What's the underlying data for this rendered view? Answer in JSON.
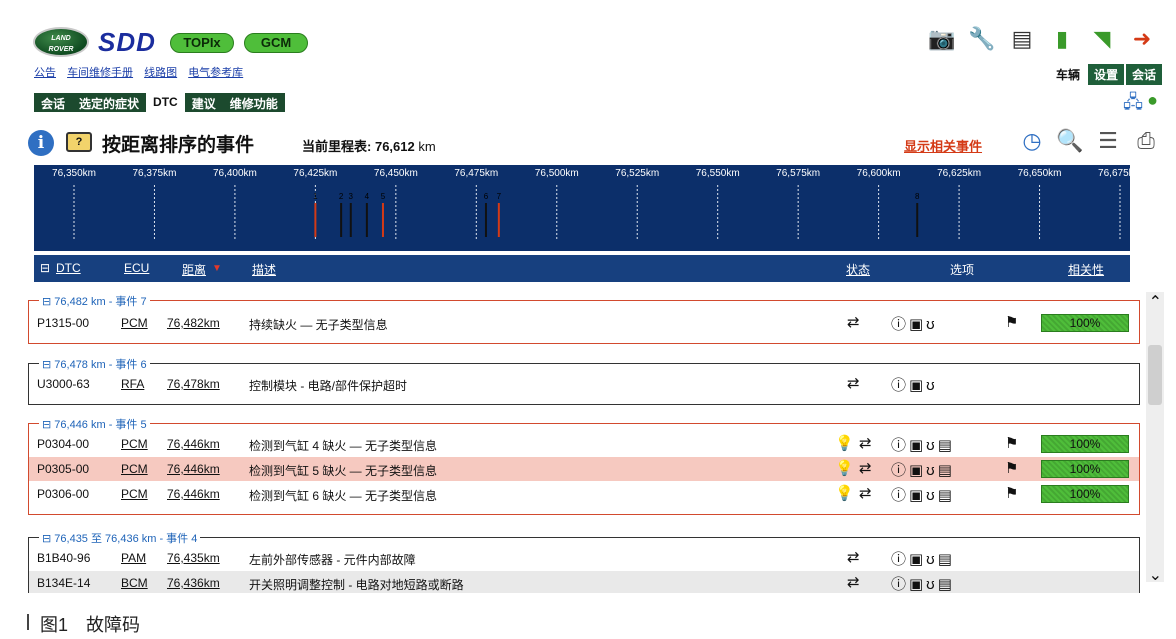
{
  "header": {
    "logo_text": "LAND ROVER",
    "brand": "SDD",
    "pills": [
      "TOPIx",
      "GCM"
    ],
    "links": [
      "公告",
      "车间维修手册",
      "线路图",
      "电气参考库"
    ],
    "icons": [
      "camera-icon",
      "wrench-icon",
      "battery-icon",
      "book-icon",
      "wifi-icon",
      "exit-icon"
    ],
    "right_tabs": [
      "车辆",
      "设置",
      "会话"
    ]
  },
  "nav": {
    "tabs": [
      "会话",
      "选定的症状",
      "DTC",
      "建议",
      "维修功能"
    ],
    "active": "DTC"
  },
  "title": {
    "text": "按距离排序的事件",
    "odo_label": "当前里程表:",
    "odo_value": "76,612",
    "odo_unit": "km",
    "show_related": "显示相关事件"
  },
  "timeline": {
    "ticks": [
      "76,350km",
      "76,375km",
      "76,400km",
      "76,425km",
      "76,450km",
      "76,475km",
      "76,500km",
      "76,525km",
      "76,550km",
      "76,575km",
      "76,600km",
      "76,625km",
      "76,650km",
      "76,675km"
    ],
    "tick_values": [
      76350,
      76375,
      76400,
      76425,
      76450,
      76475,
      76500,
      76525,
      76550,
      76575,
      76600,
      76625,
      76650,
      76675
    ],
    "events": [
      {
        "label": "1",
        "km": 76425,
        "color": "#d43a16"
      },
      {
        "label": "2",
        "km": 76433,
        "color": "#111111"
      },
      {
        "label": "3",
        "km": 76436,
        "color": "#111111"
      },
      {
        "label": "4",
        "km": 76441,
        "color": "#111111"
      },
      {
        "label": "5",
        "km": 76446,
        "color": "#d43a16"
      },
      {
        "label": "6",
        "km": 76478,
        "color": "#111111"
      },
      {
        "label": "7",
        "km": 76482,
        "color": "#d43a16"
      },
      {
        "label": "8",
        "km": 76612,
        "color": "#111111"
      }
    ]
  },
  "table": {
    "headers": {
      "dtc": "DTC",
      "ecu": "ECU",
      "distance": "距离",
      "desc": "描述",
      "status": "状态",
      "options": "选项",
      "relevance": "相关性"
    }
  },
  "groups": [
    {
      "title": "76,482 km - 事件 7",
      "rows": [
        {
          "code": "P1315-00",
          "ecu": "PCM",
          "dist": "76,482km",
          "desc": "持续缺火 — 无子类型信息",
          "bar": "100%"
        }
      ]
    },
    {
      "title": "76,478 km - 事件 6",
      "rows": [
        {
          "code": "U3000-63",
          "ecu": "RFA",
          "dist": "76,478km",
          "desc": "控制模块 - 电路/部件保护超时"
        }
      ]
    },
    {
      "title": "76,446 km - 事件 5",
      "rows": [
        {
          "code": "P0304-00",
          "ecu": "PCM",
          "dist": "76,446km",
          "desc": "检测到气缸 4 缺火 — 无子类型信息",
          "bar": "100%"
        },
        {
          "code": "P0305-00",
          "ecu": "PCM",
          "dist": "76,446km",
          "desc": "检测到气缸 5 缺火 — 无子类型信息",
          "bar": "100%"
        },
        {
          "code": "P0306-00",
          "ecu": "PCM",
          "dist": "76,446km",
          "desc": "检测到气缸 6 缺火 — 无子类型信息",
          "bar": "100%"
        }
      ]
    },
    {
      "title": "76,435 至 76,436 km - 事件 4",
      "rows": [
        {
          "code": "B1B40-96",
          "ecu": "PAM",
          "dist": "76,435km",
          "desc": "左前外部传感器 - 元件内部故障"
        },
        {
          "code": "B134E-14",
          "ecu": "BCM",
          "dist": "76,436km",
          "desc": "开关照明调整控制 - 电路对地短路或断路"
        }
      ]
    }
  ],
  "caption": "图1　故障码"
}
